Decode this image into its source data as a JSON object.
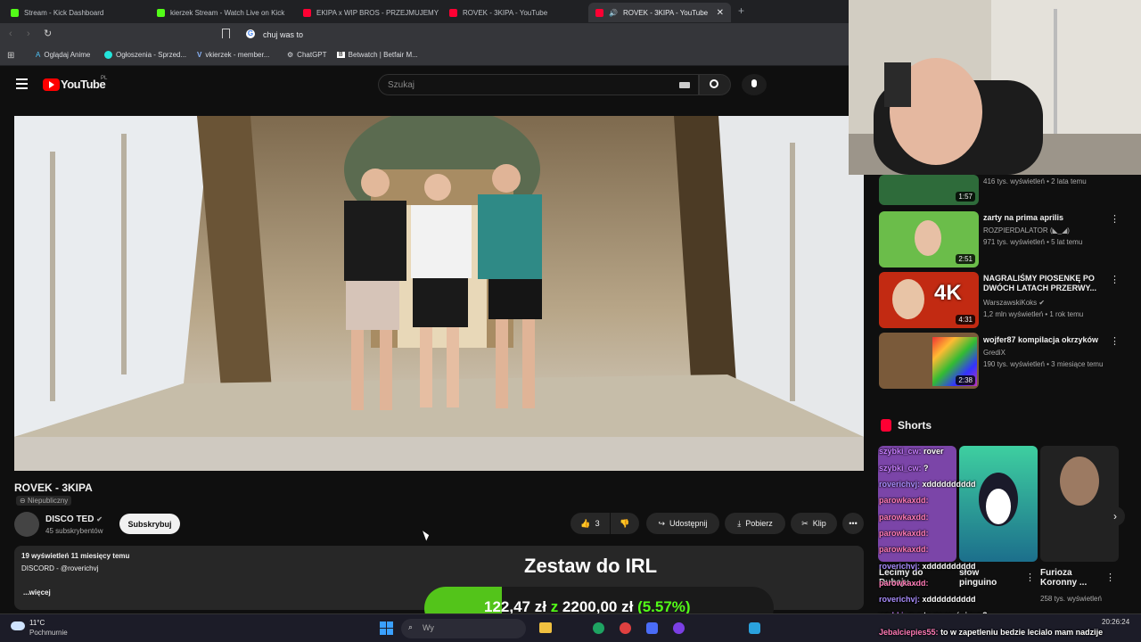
{
  "tabs": [
    {
      "label": "Stream - Kick Dashboard",
      "color": "#53fc18"
    },
    {
      "label": "kierzek Stream - Watch Live on Kick",
      "color": "#53fc18"
    },
    {
      "label": "EKIPA x WIP BROS - PRZEJMUJEMY JI",
      "color": "#ff0033"
    },
    {
      "label": "ROVEK - 3KIPA - YouTube",
      "color": "#ff0033"
    },
    {
      "label": "ROVEK - 3KIPA - YouTube",
      "color": "#ff0033"
    }
  ],
  "address": "chuj was to",
  "bookmarks": [
    "Oglądaj Anime",
    "Ogłoszenia - Sprzed...",
    "vkierzek - member...",
    "ChatGPT",
    "Betwatch | Betfair M..."
  ],
  "youtube": {
    "logo": "YouTube",
    "region": "PL",
    "search_placeholder": "Szukaj"
  },
  "video": {
    "title": "ROVEK - 3KIPA",
    "visibility": "Niepubliczny",
    "channel": "DISCO TED",
    "subscribers": "45 subskrybentów",
    "subscribe_label": "Subskrybuj",
    "likes": "3",
    "share_label": "Udostępnij",
    "download_label": "Pobierz",
    "clip_label": "Klip",
    "views_line": "19 wyświetleń  11 miesięcy temu",
    "description": "DISCORD - @roverichvj",
    "more_label": "...więcej"
  },
  "sidebar": {
    "items": [
      {
        "title": "",
        "channel": "",
        "meta": "416 tys. wyświetleń • 2 lata temu",
        "duration": "1:57"
      },
      {
        "title": "zarty na prima aprilis",
        "channel": "ROZPIERDALATOR (◣_◢)",
        "meta": "971 tys. wyświetleń • 5 lat temu",
        "duration": "2:51"
      },
      {
        "title": "NAGRALIŚMY PIOSENKĘ PO DWÓCH LATACH PRZERWY...",
        "channel": "WarszawskiKoks",
        "meta": "1,2 mln wyświetleń • 1 rok temu",
        "duration": "4:31"
      },
      {
        "title": "wojfer87 kompilacja okrzyków",
        "channel": "GrediX",
        "meta": "190 tys. wyświetleń • 3 miesiące temu",
        "duration": "2:38"
      }
    ],
    "shorts_label": "Shorts",
    "shorts": [
      {
        "title": "Lecimy do Dubaju...",
        "meta": ""
      },
      {
        "title": "słow pinguino",
        "meta": ""
      },
      {
        "title": "Furioza Koronny ...",
        "meta": "258 tys. wyświetleń"
      }
    ]
  },
  "overlay": {
    "goal_title": "Zestaw do IRL",
    "current": "122,47 zł",
    "z": "z",
    "target": "2200,00 zł",
    "percent": "(5.57%)",
    "progress_fraction": 0.0557
  },
  "chat": [
    {
      "user": "szybki_cw:",
      "text": "rover"
    },
    {
      "user": "szybki_cw:",
      "text": "?"
    },
    {
      "user": "roverichvj:",
      "text": "xdddddddddd"
    },
    {
      "user": "parowkaxdd:",
      "text": ""
    },
    {
      "user": "parowkaxdd:",
      "text": ""
    },
    {
      "user": "parowkaxdd:",
      "text": ""
    },
    {
      "user": "parowkaxdd:",
      "text": ""
    },
    {
      "user": "roverichvj:",
      "text": "xdddddddddd"
    },
    {
      "user": "parowkaxdd:",
      "text": ""
    },
    {
      "user": "roverichvj:",
      "text": "xdddddddddd"
    },
    {
      "user": "szybki_cw:",
      "text": "to rover śpiewa?"
    },
    {
      "user": "Jebalciepies55:",
      "text": "to w zapetleniu bedzie lecialo mam nadzije"
    }
  ],
  "taskbar": {
    "temp": "11°C",
    "weather": "Pochmurnie",
    "search": "Wy",
    "time": "20:26:24",
    "date": "..."
  }
}
